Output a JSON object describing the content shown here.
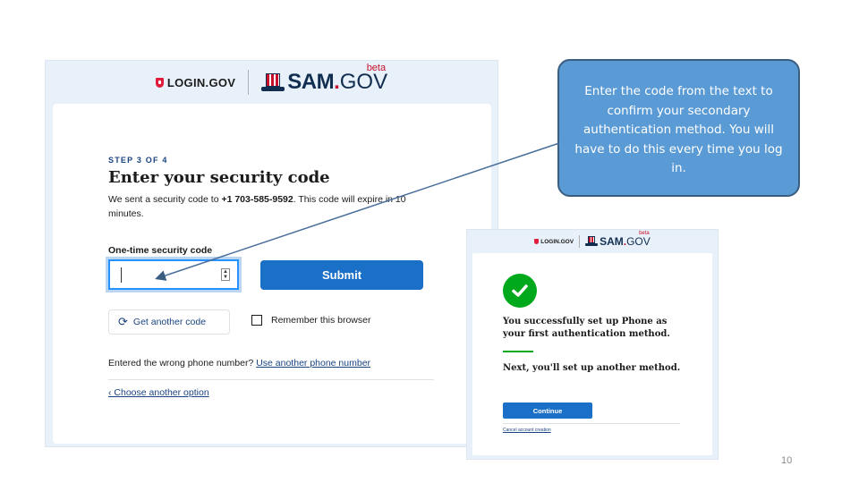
{
  "shot1": {
    "login_brand": "LOGIN.GOV",
    "sam_brand": "SAM",
    "sam_dot": ".",
    "gov_brand": "GOV",
    "beta": "beta",
    "step": "STEP 3 OF 4",
    "title": "Enter your security code",
    "sent_prefix": "We sent a security code to ",
    "phone": "+1 703-585-9592",
    "sent_suffix": ". This code will expire in 10 minutes.",
    "otp_label": "One-time security code",
    "otp_value": "",
    "submit_label": "Submit",
    "another_code_label": "Get another code",
    "remember_label": "Remember this browser",
    "wrong_number_text": "Entered the wrong phone number?",
    "wrong_number_link": "Use another phone number",
    "choose_option": "‹ Choose another option"
  },
  "callout": {
    "text": "Enter the code from the text to confirm your secondary authentication method. You will have to do this every time you log in."
  },
  "shot2": {
    "login_brand": "LOGIN.GOV",
    "sam_brand": "SAM",
    "sam_dot": ".",
    "gov_brand": "GOV",
    "beta": "beta",
    "success_text": "You successfully set up Phone as your first authentication method.",
    "next_text": "Next, you'll set up another method.",
    "continue_label": "Continue",
    "cancel_label": "Cancel account creation"
  },
  "page_number": "10",
  "colors": {
    "primary_button": "#1a6fc6",
    "callout_fill": "#5b9bd5",
    "success_green": "#00a91c",
    "brand_red": "#c8102e"
  }
}
